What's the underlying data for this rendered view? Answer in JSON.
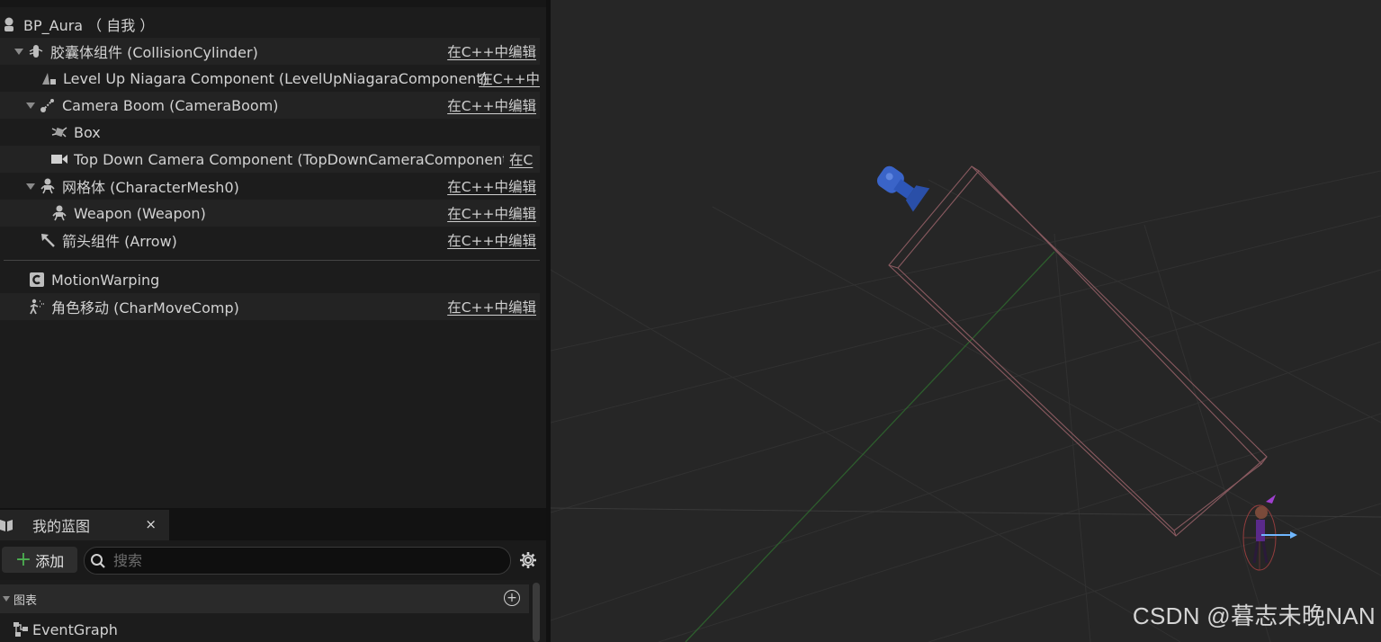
{
  "components": {
    "root": {
      "label": "BP_Aura （ 自我 ）",
      "icon": "pawn-icon"
    },
    "items": [
      {
        "label": "胶囊体组件 (CollisionCylinder)",
        "edit": "在C++中编辑",
        "icon": "capsule-icon"
      },
      {
        "label": "Level Up Niagara Component (LevelUpNiagaraComponent)",
        "edit": "在C++中",
        "icon": "niagara-icon"
      },
      {
        "label": "Camera Boom (CameraBoom)",
        "edit": "在C++中编辑",
        "icon": "spring-arm-icon"
      },
      {
        "label": "Box",
        "edit": "",
        "icon": "box-collision-icon"
      },
      {
        "label": "Top Down Camera Component (TopDownCameraComponent)",
        "edit": "在C",
        "icon": "camera-icon"
      },
      {
        "label": "网格体 (CharacterMesh0)",
        "edit": "在C++中编辑",
        "icon": "skeletal-mesh-icon"
      },
      {
        "label": "Weapon (Weapon)",
        "edit": "在C++中编辑",
        "icon": "skeletal-mesh-icon"
      },
      {
        "label": "箭头组件 (Arrow)",
        "edit": "在C++中编辑",
        "icon": "arrow-component-icon"
      },
      {
        "label": "MotionWarping",
        "edit": "",
        "icon": "actor-component-icon"
      },
      {
        "label": "角色移动 (CharMoveComp)",
        "edit": "在C++中编辑",
        "icon": "movement-icon"
      }
    ]
  },
  "my_blueprint": {
    "tab_label": "我的蓝图",
    "close": "×",
    "add_label": "添加",
    "search_placeholder": "搜索",
    "graphs_header": "图表",
    "event_graph": "EventGraph"
  },
  "viewport": {
    "watermark": "CSDN @暮志未晚NAN"
  }
}
